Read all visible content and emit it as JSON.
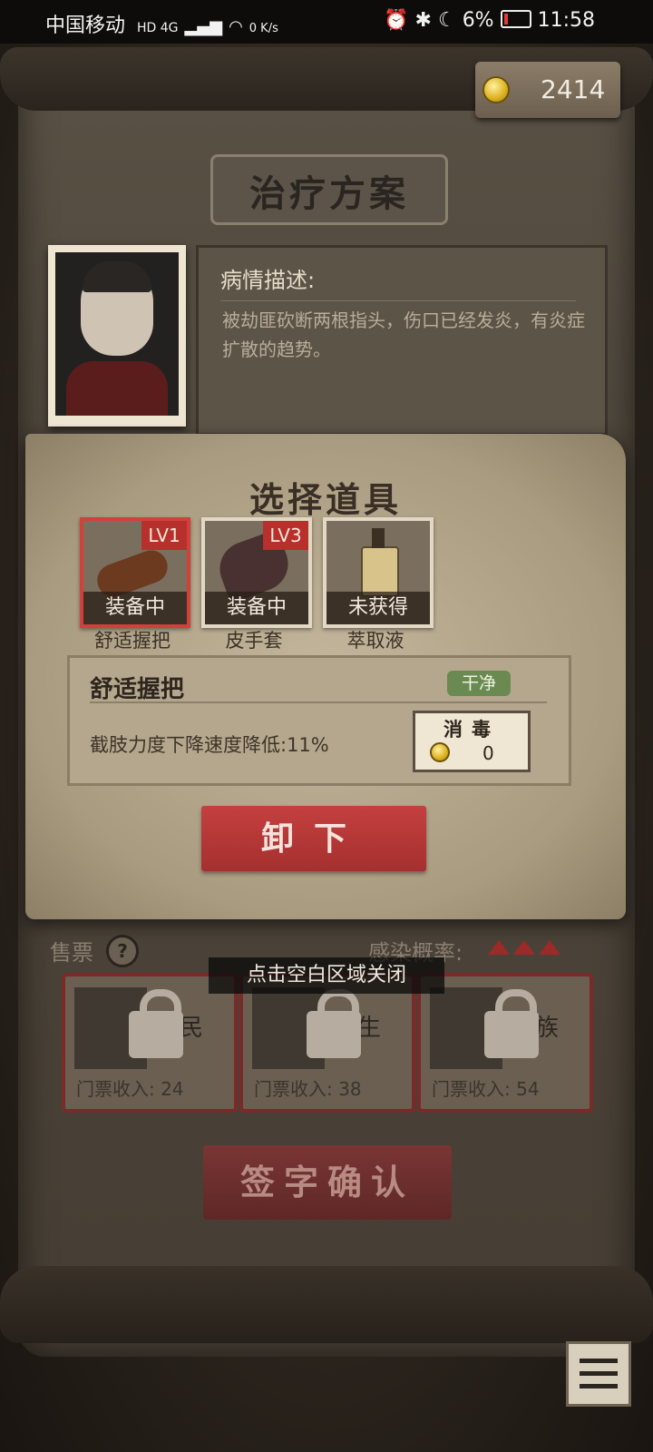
{
  "status_bar": {
    "carrier": "中国移动",
    "network": "HD 4G",
    "speed": "0 K/s",
    "battery": "6%",
    "time": "11:58"
  },
  "currency": {
    "icon": "coin-icon",
    "amount": "2414"
  },
  "title": "治疗方案",
  "patient": {
    "description_title": "病情描述:",
    "description": "被劫匪砍断两根指头，伤口已经发炎，有炎症扩散的趋势。"
  },
  "popup": {
    "title": "选择道具",
    "tools": [
      {
        "name": "舒适握把",
        "level": "LV1",
        "state": "装备中",
        "selected": true
      },
      {
        "name": "皮手套",
        "level": "LV3",
        "state": "装备中",
        "selected": false
      },
      {
        "name": "萃取液",
        "level": "",
        "state": "未获得",
        "selected": false
      }
    ],
    "detail": {
      "name": "舒适握把",
      "tag": "干净",
      "effect": "截肢力度下降速度降低:11%",
      "disinfect_label": "消毒",
      "disinfect_cost": "0"
    },
    "unequip_label": "卸下"
  },
  "hint": "点击空白区域关闭",
  "tickets": {
    "label": "售票",
    "help": "?",
    "infection_label": "感染概率:",
    "cards": [
      {
        "name": "平民",
        "income": "门票收入: 24"
      },
      {
        "name": "学生",
        "income": "门票收入: 38"
      },
      {
        "name": "贵族",
        "income": "门票收入: 54"
      }
    ]
  },
  "sign_label": "签字确认",
  "colors": {
    "accent_red": "#b7302c",
    "tag_green": "#6b8a52"
  }
}
